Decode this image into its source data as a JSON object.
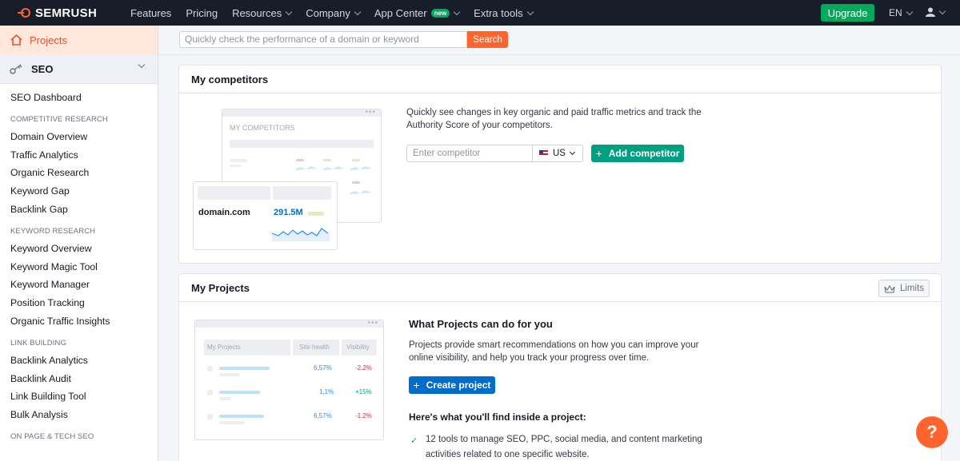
{
  "topbar": {
    "brand": "SEMRUSH",
    "nav": [
      {
        "label": "Features",
        "dropdown": false
      },
      {
        "label": "Pricing",
        "dropdown": false
      },
      {
        "label": "Resources",
        "dropdown": true
      },
      {
        "label": "Company",
        "dropdown": true
      },
      {
        "label": "App Center",
        "dropdown": true,
        "badge": "new"
      },
      {
        "label": "Extra tools",
        "dropdown": true
      }
    ],
    "upgrade_label": "Upgrade",
    "language": "EN",
    "icons": {
      "logo": "semrush-flame-logo",
      "user": "user-icon"
    }
  },
  "sidebar": {
    "projects_label": "Projects",
    "seo_label": "SEO",
    "dashboard_label": "SEO Dashboard",
    "sections": [
      {
        "heading": "COMPETITIVE RESEARCH",
        "items": [
          "Domain Overview",
          "Traffic Analytics",
          "Organic Research",
          "Keyword Gap",
          "Backlink Gap"
        ]
      },
      {
        "heading": "KEYWORD RESEARCH",
        "items": [
          "Keyword Overview",
          "Keyword Magic Tool",
          "Keyword Manager",
          "Position Tracking",
          "Organic Traffic Insights"
        ]
      },
      {
        "heading": "LINK BUILDING",
        "items": [
          "Backlink Analytics",
          "Backlink Audit",
          "Link Building Tool",
          "Bulk Analysis"
        ]
      },
      {
        "heading": "ON PAGE & TECH SEO",
        "items": []
      }
    ]
  },
  "search": {
    "placeholder": "Quickly check the performance of a domain or keyword",
    "button_label": "Search"
  },
  "competitors_card": {
    "title": "My competitors",
    "description": "Quickly see changes in key organic and paid traffic metrics and track the Authority Score of your competitors.",
    "input_placeholder": "Enter competitor",
    "country": "US",
    "add_label": "Add competitor",
    "mock": {
      "header": "MY COMPETITORS",
      "domain": "domain.com",
      "value": "291.5M"
    }
  },
  "projects_card": {
    "title": "My Projects",
    "limits_label": "Limits",
    "heading": "What Projects can do for you",
    "description": "Projects provide smart recommendations on how you can improve your online visibility, and help you track your progress over time.",
    "create_label": "Create project",
    "inside_heading": "Here's what you'll find inside a project:",
    "features": [
      "12 tools to manage SEO, PPC, social media, and content marketing activities related to one specific website."
    ],
    "mock": {
      "columns": [
        "My Projects",
        "Site health",
        "Visibility"
      ],
      "rows": [
        {
          "health": "6,57%",
          "visibility": "-2.2%",
          "trend": "down"
        },
        {
          "health": "1,1%",
          "visibility": "+15%",
          "trend": "up"
        },
        {
          "health": "6,57%",
          "visibility": "-1.2%",
          "trend": "down"
        }
      ]
    }
  },
  "help_label": "?",
  "colors": {
    "accent": "#ff642d",
    "green": "#009f81",
    "blue": "#006dca",
    "topbar": "#181e29"
  }
}
